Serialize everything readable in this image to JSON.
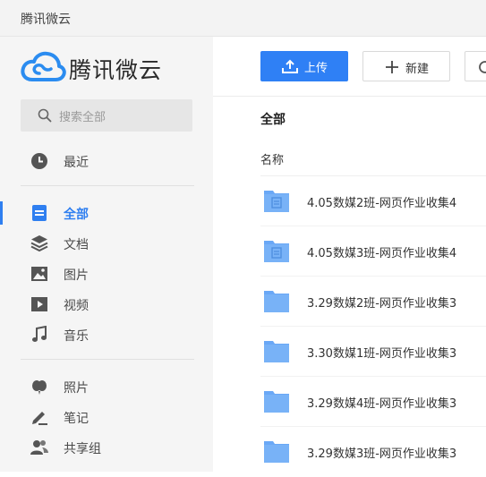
{
  "window": {
    "title": "腾讯微云"
  },
  "sidebar": {
    "logo_text": "腾讯微云",
    "search_placeholder": "搜索全部",
    "items": [
      {
        "label": "最近",
        "icon": "clock-icon"
      },
      {
        "label": "全部",
        "icon": "document-icon",
        "active": true
      },
      {
        "label": "文档",
        "icon": "layers-icon"
      },
      {
        "label": "图片",
        "icon": "image-icon"
      },
      {
        "label": "视频",
        "icon": "play-icon"
      },
      {
        "label": "音乐",
        "icon": "music-note-icon"
      },
      {
        "label": "照片",
        "icon": "balloon-icon"
      },
      {
        "label": "笔记",
        "icon": "pen-icon"
      },
      {
        "label": "共享组",
        "icon": "group-icon"
      }
    ]
  },
  "toolbar": {
    "upload_label": "上传",
    "new_label": "新建"
  },
  "main": {
    "breadcrumb": "全部",
    "column_name": "名称",
    "files": [
      {
        "name": "4.05数媒2班-网页作业收集4",
        "icon": "collection-folder-icon"
      },
      {
        "name": "4.05数媒3班-网页作业收集4",
        "icon": "collection-folder-icon"
      },
      {
        "name": "3.29数媒2班-网页作业收集3",
        "icon": "folder-icon"
      },
      {
        "name": "3.30数媒1班-网页作业收集3",
        "icon": "folder-icon"
      },
      {
        "name": "3.29数媒4班-网页作业收集3",
        "icon": "folder-icon"
      },
      {
        "name": "3.29数媒3班-网页作业收集3",
        "icon": "folder-icon"
      }
    ]
  },
  "colors": {
    "accent": "#2f80f5",
    "folder": "#6aa8f6",
    "sidebar_bg": "#f5f5f5"
  }
}
